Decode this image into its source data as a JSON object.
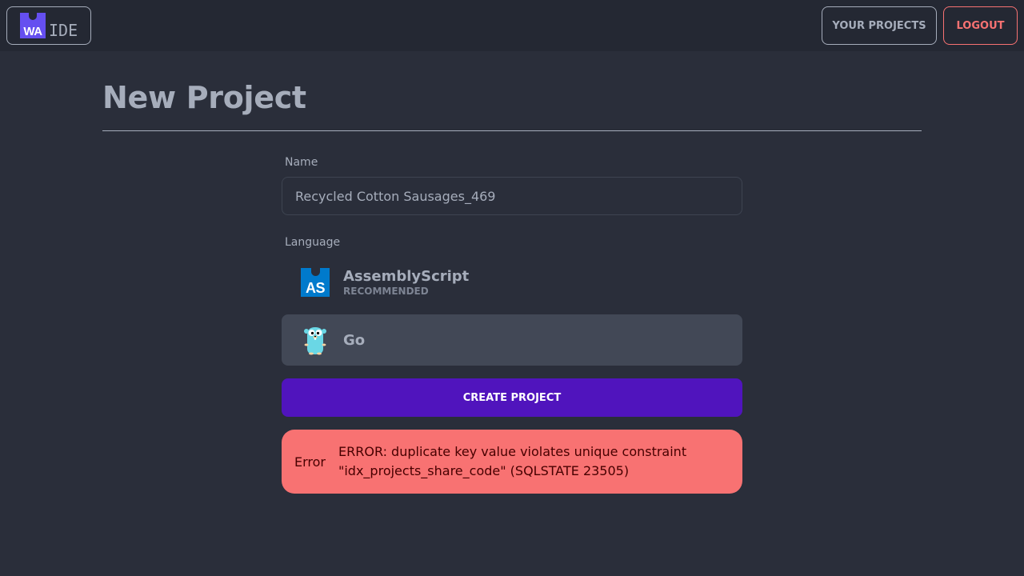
{
  "navbar": {
    "logo_badge": "WA",
    "logo_text": "IDE",
    "your_projects_label": "YOUR PROJECTS",
    "logout_label": "LOGOUT"
  },
  "page": {
    "title": "New Project"
  },
  "form": {
    "name_label": "Name",
    "name_value": "Recycled Cotton Sausages_469",
    "language_label": "Language",
    "languages": [
      {
        "icon": "assemblyscript-logo-icon",
        "badge": "AS",
        "name": "AssemblyScript",
        "subtitle": "RECOMMENDED",
        "selected": false
      },
      {
        "icon": "go-gopher-icon",
        "name": "Go",
        "selected": true
      }
    ],
    "create_label": "CREATE PROJECT"
  },
  "error": {
    "label": "Error",
    "message": "ERROR: duplicate key value violates unique constraint \"idx_projects_share_code\" (SQLSTATE 23505)"
  },
  "colors": {
    "background": "#2a2e3a",
    "navbar": "#242833",
    "primary": "#5014bd",
    "wasm_brand": "#654ff0",
    "assemblyscript_brand": "#007acc",
    "error": "#f87272",
    "selected_option": "#424856"
  }
}
